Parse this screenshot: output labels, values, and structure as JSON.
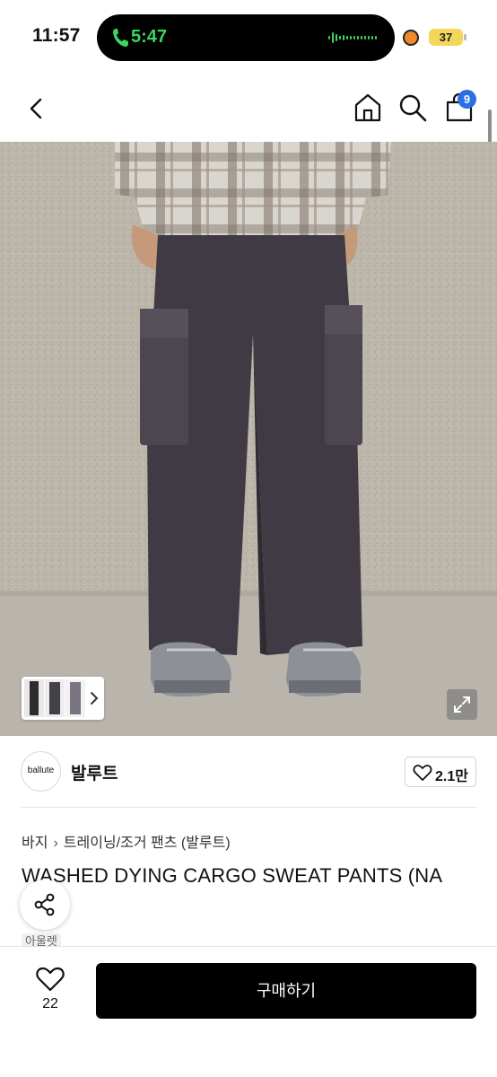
{
  "status_bar": {
    "time": "11:57",
    "call_time": "5:47",
    "battery": "37"
  },
  "nav": {
    "cart_count": "9",
    "icons": [
      "back-arrow-icon",
      "home-icon",
      "search-icon",
      "shopping-bag-icon"
    ]
  },
  "gallery": {
    "expand_icon": "expand-icon",
    "thumb_arrow": "chevron-right-icon"
  },
  "brand": {
    "logo_text": "ballute",
    "name": "발루트",
    "likes": "2.1만"
  },
  "product": {
    "breadcrumb": [
      "바지",
      "트레이닝/조거 팬츠 (발루트)"
    ],
    "title": "WASHED DYING CARGO SWEAT PANTS (NA",
    "tag": "아울렛"
  },
  "bottom_bar": {
    "wish_count": "22",
    "buy_label": "구매하기"
  },
  "colors": {
    "accent_badge": "#2c6fe3",
    "call_green": "#3fd363",
    "buy_button": "#000000"
  }
}
